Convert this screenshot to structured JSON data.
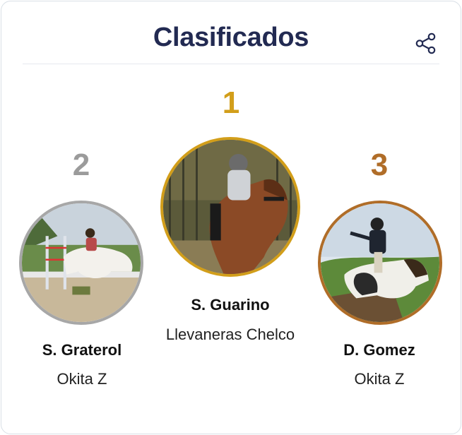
{
  "header": {
    "title": "Clasificados",
    "share_icon": "share-icon"
  },
  "podium": [
    {
      "rank": "1",
      "rider": "S. Guarino",
      "horse": "Llevaneras Chelco",
      "ring_color": "#d29e1a"
    },
    {
      "rank": "2",
      "rider": "S. Graterol",
      "horse": "Okita Z",
      "ring_color": "#a7a7a7"
    },
    {
      "rank": "3",
      "rider": "D. Gomez",
      "horse": "Okita Z",
      "ring_color": "#b06d28"
    }
  ]
}
